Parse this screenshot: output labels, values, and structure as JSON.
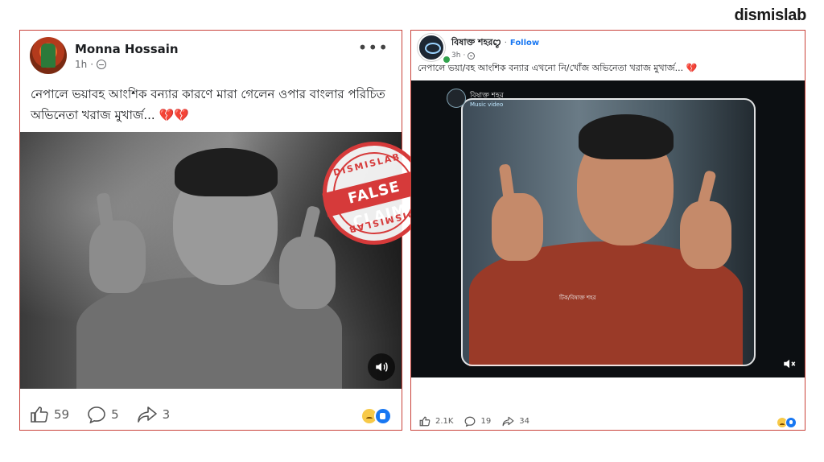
{
  "brand": "dismislab",
  "left_post": {
    "author": "Monna Hossain",
    "time": "1h",
    "privacy_icon": "globe-icon",
    "more_icon": "more-options-icon",
    "caption": "নেপালে ভয়াবহ আংশিক বন্যার কারণে মারা গেলেন ওপার বাংলার পরিচিত অভিনেতা খরাজ মুখার্জ...",
    "caption_emoji": "💔💔",
    "stamp": {
      "top_text": "DISMISLAB",
      "band_text": "FALSE CLAIM",
      "bottom_text": "DISMISLAB",
      "color": "#d63a3a"
    },
    "media_style": "grayscale",
    "likes": "59",
    "comments": "5",
    "shares": "3"
  },
  "right_post": {
    "author": "বিষাক্ত শহরꨄ",
    "follow_label": "Follow",
    "time": "3h",
    "caption": "নেপালে ভয়া/বহ আংশিক বন্যার এখনো নি/খোঁজ অভিনেতা খরাজ মুখার্জ...",
    "caption_emoji": "💔",
    "channel_name": "বিষাক্ত শহর",
    "channel_tag": "Music video",
    "watermark": "টিক/বিষাক্ত শহর",
    "likes": "2.1K",
    "comments": "19",
    "shares": "34"
  },
  "colors": {
    "facebook_blue": "#1877f2",
    "stamp_red": "#d63a3a",
    "card_border": "#c9423a"
  }
}
